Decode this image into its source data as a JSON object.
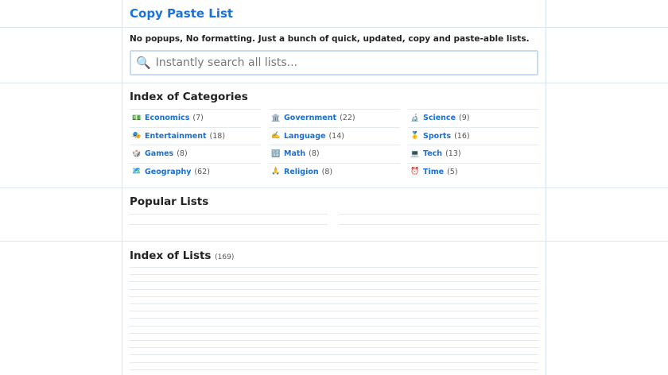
{
  "header": {
    "title": "Copy Paste List"
  },
  "tagline": "No popups, No formatting. Just a bunch of quick, updated, copy and paste-able lists.",
  "search": {
    "placeholder": "Instantly search all lists...",
    "icon": "magnifier-icon"
  },
  "categories": {
    "heading": "Index of Categories",
    "items": [
      {
        "emoji": "💵",
        "label": "Economics",
        "count": "(7)"
      },
      {
        "emoji": "🏛️",
        "label": "Government",
        "count": "(22)"
      },
      {
        "emoji": "🔬",
        "label": "Science",
        "count": "(9)"
      },
      {
        "emoji": "🎭",
        "label": "Entertainment",
        "count": "(18)"
      },
      {
        "emoji": "✍️",
        "label": "Language",
        "count": "(14)"
      },
      {
        "emoji": "🥇",
        "label": "Sports",
        "count": "(16)"
      },
      {
        "emoji": "🎲",
        "label": "Games",
        "count": "(8)"
      },
      {
        "emoji": "🔢",
        "label": "Math",
        "count": "(8)"
      },
      {
        "emoji": "💻",
        "label": "Tech",
        "count": "(13)"
      },
      {
        "emoji": "🗺️",
        "label": "Geography",
        "count": "(62)"
      },
      {
        "emoji": "🙏",
        "label": "Religion",
        "count": "(8)"
      },
      {
        "emoji": "⏰",
        "label": "Time",
        "count": "(5)"
      }
    ]
  },
  "popular": {
    "heading": "Popular Lists"
  },
  "index": {
    "heading": "Index of Lists",
    "count": "(169)"
  }
}
